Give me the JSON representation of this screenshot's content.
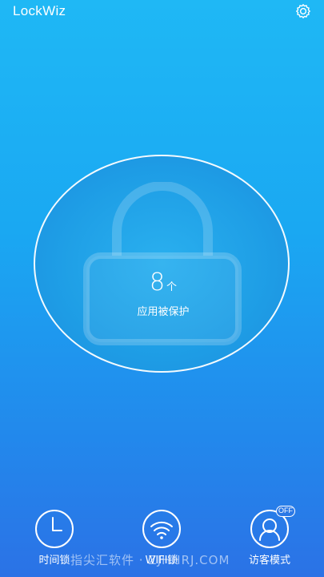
{
  "header": {
    "app_title": "LockWiz",
    "settings_icon": "gear-icon"
  },
  "lock_panel": {
    "lock_icon": "padlock-icon",
    "protected_count": "8",
    "count_unit": "个",
    "protected_label": "应用被保护"
  },
  "bottom_nav": {
    "items": [
      {
        "label": "时间锁",
        "icon": "clock-icon"
      },
      {
        "label": "WIFI锁",
        "icon": "wifi-icon"
      },
      {
        "label": "访客模式",
        "icon": "visitor-icon"
      }
    ],
    "visitor_mode_badge": "OFF"
  },
  "watermark": "指尖汇软件 · ZJHHRJ.COM",
  "colors": {
    "background_top": "#1fb8f5",
    "background_bottom": "#2b72e6",
    "circle_fill": "#1f9fe6",
    "foreground": "#ffffff"
  }
}
